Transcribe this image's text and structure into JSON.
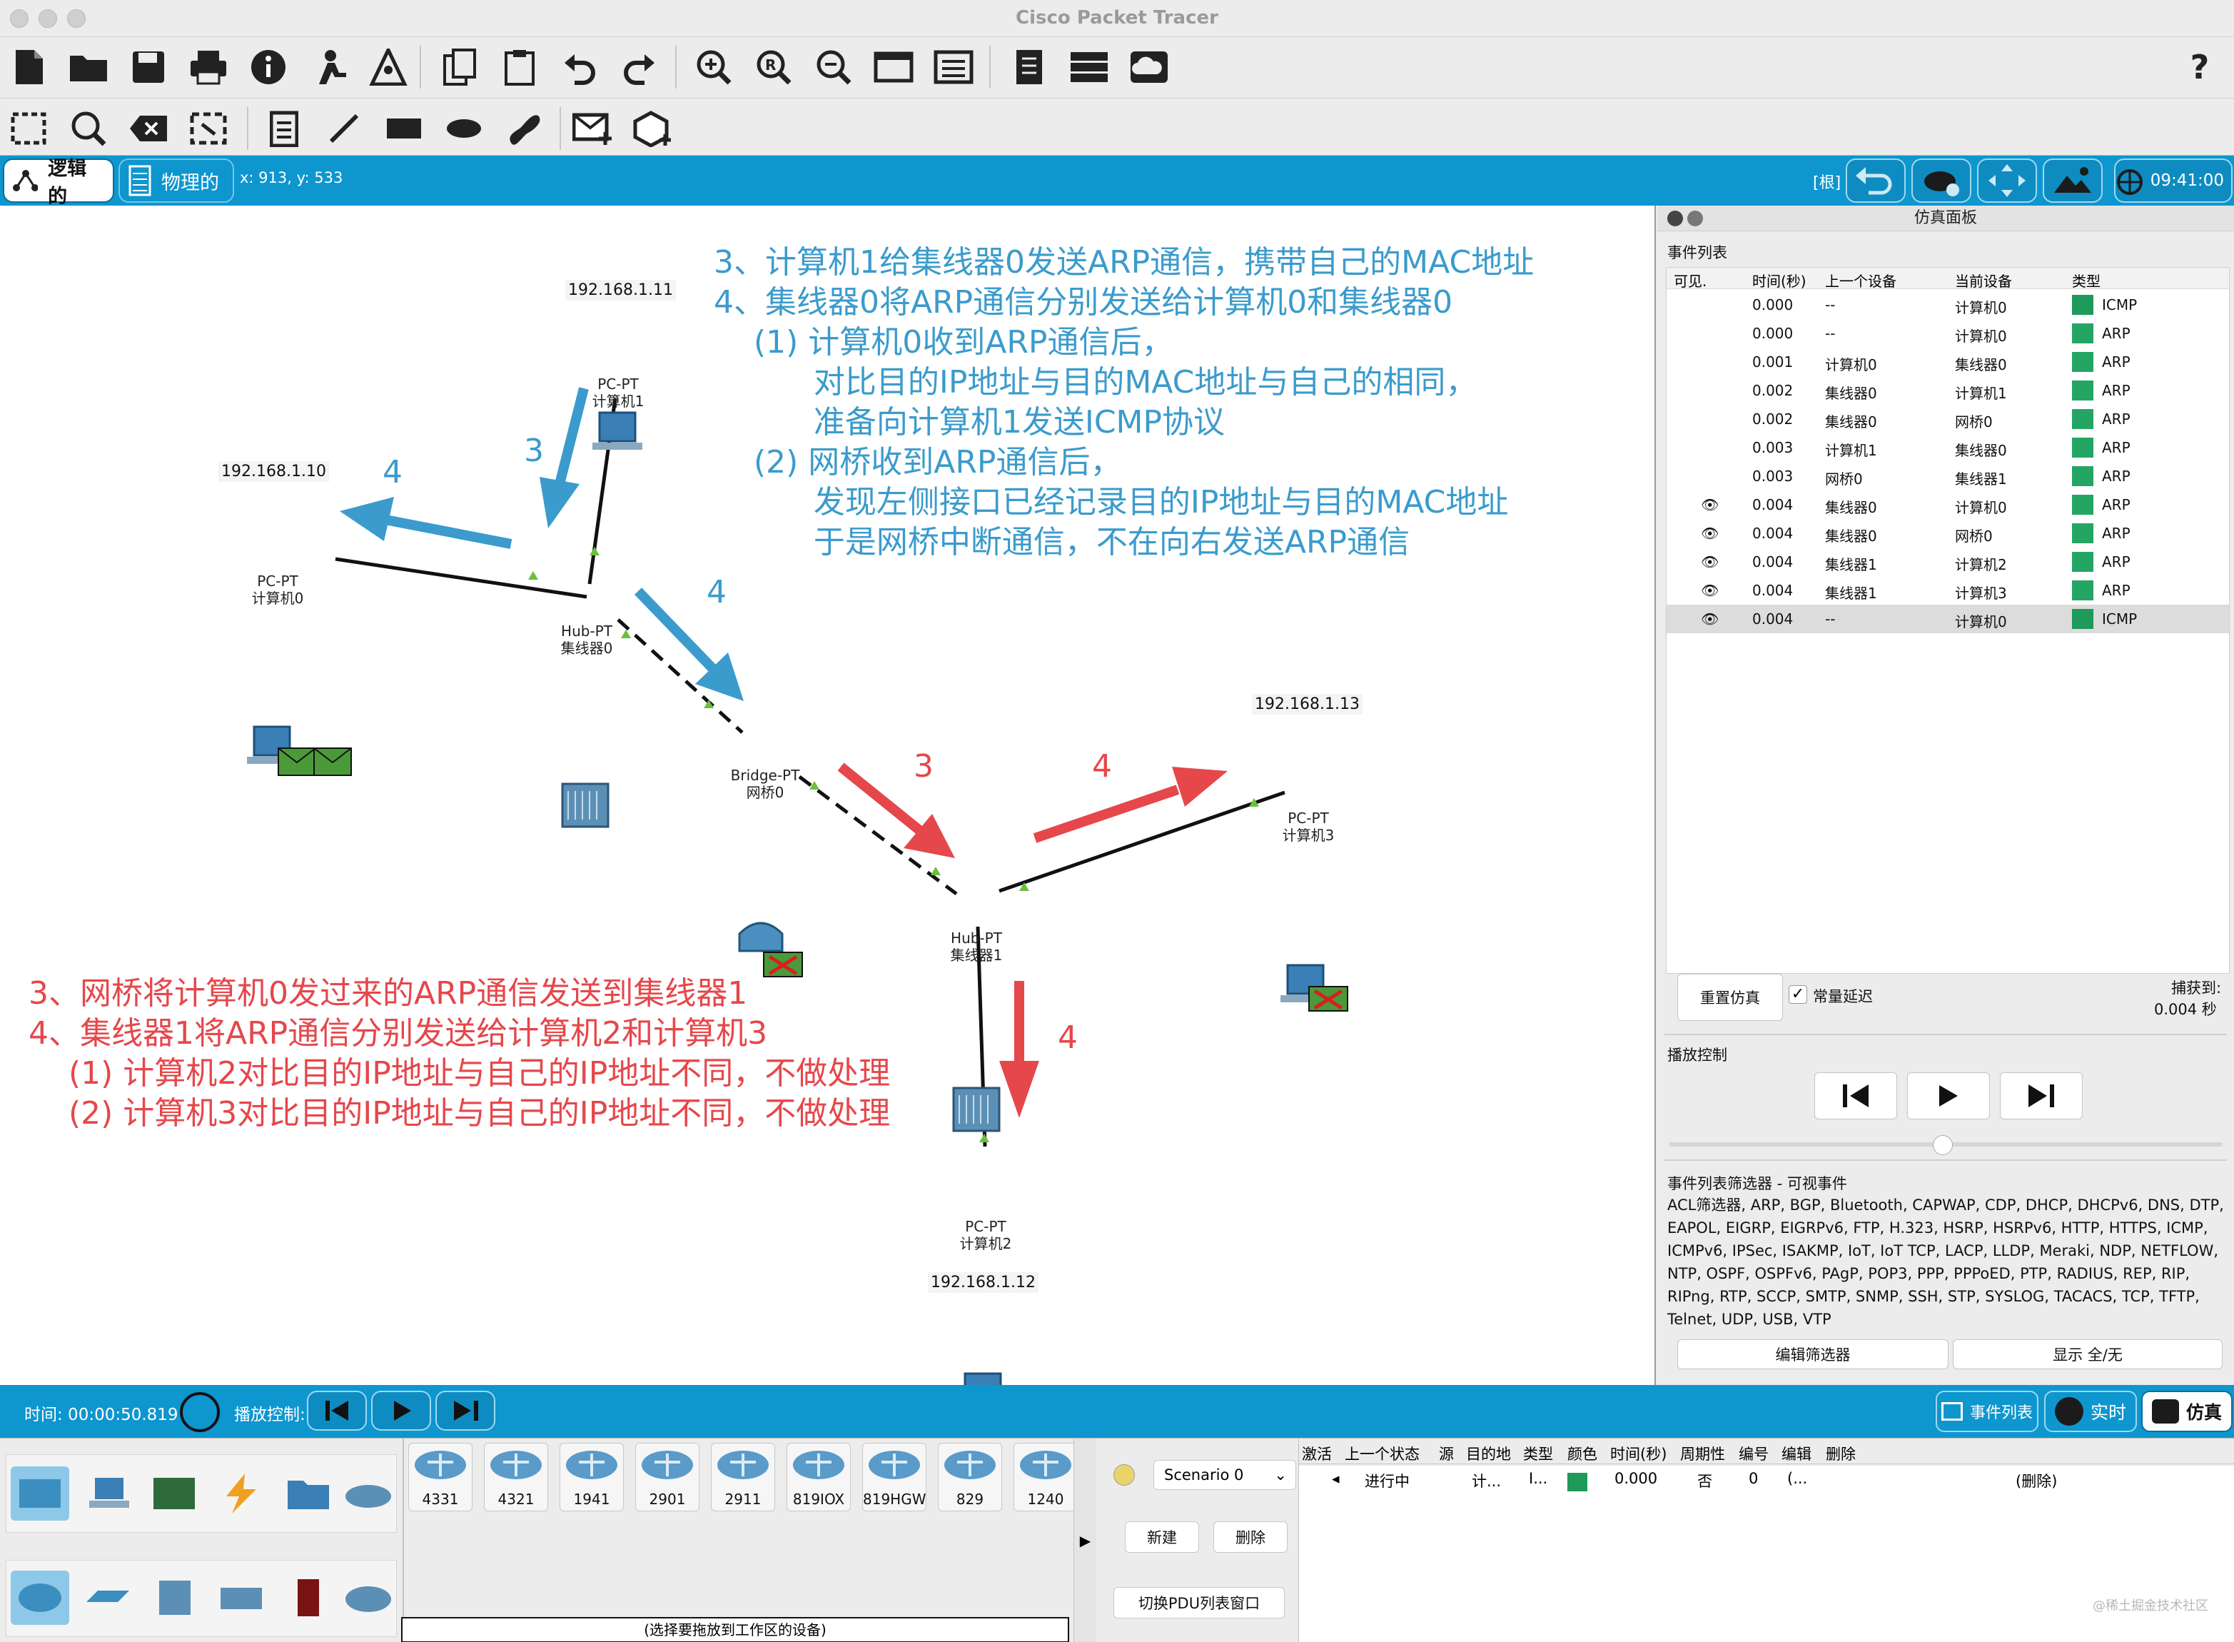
{
  "window": {
    "title": "Cisco Packet Tracer"
  },
  "toolbar1_icons": [
    "new-file-icon",
    "open-folder-icon",
    "save-icon",
    "print-icon",
    "info-icon",
    "activity-wizard-icon",
    "network-info-icon",
    "copy-icon",
    "paste-icon",
    "undo-icon",
    "redo-icon",
    "zoom-in-icon",
    "zoom-reset-icon",
    "zoom-out-icon",
    "drawing-palette-icon",
    "custom-device-icon",
    "view-ipc-icon",
    "server-icon",
    "cloud-icon",
    "help-icon"
  ],
  "toolbar2_icons": [
    "select-icon",
    "inspect-icon",
    "delete-icon",
    "resize-icon",
    "place-note-icon",
    "draw-line-icon",
    "draw-rectangle-icon",
    "draw-ellipse-icon",
    "freeform-icon",
    "add-simple-pdu-icon",
    "add-complex-pdu-icon"
  ],
  "viewbar": {
    "logical": "逻辑的",
    "physical": "物理的",
    "coords": "x: 913, y: 533",
    "root": "[根]",
    "clock": "09:41:00"
  },
  "annotations": {
    "blue": "3、计算机1给集线器0发送ARP通信，携带自己的MAC地址\n4、集线器0将ARP通信分别发送给计算机0和集线器0\n    (1) 计算机0收到ARP通信后，\n          对比目的IP地址与目的MAC地址与自己的相同，\n          准备向计算机1发送ICMP协议\n    (2) 网桥收到ARP通信后，\n          发现左侧接口已经记录目的IP地址与目的MAC地址\n          于是网桥中断通信，不在向右发送ARP通信",
    "red": "3、网桥将计算机0发过来的ARP通信发送到集线器1\n4、集线器1将ARP通信分别发送给计算机2和计算机3\n    (1) 计算机2对比目的IP地址与自己的IP地址不同，不做处理\n    (2) 计算机3对比目的IP地址与自己的IP地址不同，不做处理",
    "arrow_numbers": {
      "a": "3",
      "b": "4",
      "c": "4",
      "d": "3",
      "e": "4",
      "f": "4"
    }
  },
  "devices": {
    "pc1": {
      "type": "PC-PT",
      "name": "计算机1",
      "ip": "192.168.1.11"
    },
    "pc0": {
      "type": "PC-PT",
      "name": "计算机0",
      "ip": "192.168.1.10"
    },
    "hub0": {
      "type": "Hub-PT",
      "name": "集线器0"
    },
    "bridge0": {
      "type": "Bridge-PT",
      "name": "网桥0"
    },
    "hub1": {
      "type": "Hub-PT",
      "name": "集线器1"
    },
    "pc3": {
      "type": "PC-PT",
      "name": "计算机3",
      "ip": "192.168.1.13"
    },
    "pc2": {
      "type": "PC-PT",
      "name": "计算机2",
      "ip": "192.168.1.12"
    }
  },
  "sim_panel": {
    "title": "仿真面板",
    "event_list_label": "事件列表",
    "columns": [
      "可见.",
      "时间(秒)",
      "上一个设备",
      "当前设备",
      "类型"
    ],
    "events": [
      {
        "visible": "",
        "time": "0.000",
        "last": "--",
        "at": "计算机0",
        "type": "ICMP",
        "color": "#1e9a5a"
      },
      {
        "visible": "",
        "time": "0.000",
        "last": "--",
        "at": "计算机0",
        "type": "ARP",
        "color": "#25a564"
      },
      {
        "visible": "",
        "time": "0.001",
        "last": "计算机0",
        "at": "集线器0",
        "type": "ARP",
        "color": "#25a564"
      },
      {
        "visible": "",
        "time": "0.002",
        "last": "集线器0",
        "at": "计算机1",
        "type": "ARP",
        "color": "#25a564"
      },
      {
        "visible": "",
        "time": "0.002",
        "last": "集线器0",
        "at": "网桥0",
        "type": "ARP",
        "color": "#25a564"
      },
      {
        "visible": "",
        "time": "0.003",
        "last": "计算机1",
        "at": "集线器0",
        "type": "ARP",
        "color": "#25a564"
      },
      {
        "visible": "",
        "time": "0.003",
        "last": "网桥0",
        "at": "集线器1",
        "type": "ARP",
        "color": "#25a564"
      },
      {
        "visible": "eye",
        "time": "0.004",
        "last": "集线器0",
        "at": "计算机0",
        "type": "ARP",
        "color": "#25a564"
      },
      {
        "visible": "eye",
        "time": "0.004",
        "last": "集线器0",
        "at": "网桥0",
        "type": "ARP",
        "color": "#25a564"
      },
      {
        "visible": "eye",
        "time": "0.004",
        "last": "集线器1",
        "at": "计算机2",
        "type": "ARP",
        "color": "#25a564"
      },
      {
        "visible": "eye",
        "time": "0.004",
        "last": "集线器1",
        "at": "计算机3",
        "type": "ARP",
        "color": "#25a564"
      },
      {
        "visible": "eye",
        "time": "0.004",
        "last": "--",
        "at": "计算机0",
        "type": "ICMP",
        "color": "#1e9a5a"
      }
    ],
    "reset_label": "重置仿真",
    "constant_delay_label": "常量延迟",
    "constant_delay_checked": true,
    "captured_label": "捕获到:",
    "captured_value": "0.004 秒",
    "playback_label": "播放控制",
    "filter_title": "事件列表筛选器 - 可视事件",
    "filter_text": "ACL筛选器, ARP, BGP, Bluetooth, CAPWAP, CDP, DHCP, DHCPv6, DNS, DTP, EAPOL, EIGRP, EIGRPv6, FTP, H.323, HSRP, HSRPv6, HTTP, HTTPS, ICMP, ICMPv6, IPSec, ISAKMP, IoT, IoT TCP, LACP, LLDP, Meraki, NDP, NETFLOW, NTP, OSPF, OSPFv6, PAgP, POP3, PPP, PPPoED, PTP, RADIUS, REP, RIP, RIPng, RTP, SCCP, SMTP, SNMP, SSH, STP, SYSLOG, TACACS, TCP, TFTP, Telnet, UDP, USB, VTP",
    "edit_filter_label": "编辑筛选器",
    "show_all_label": "显示 全/无"
  },
  "bottom_bar": {
    "time_label": "时间: 00:00:50.819",
    "playback_label": "播放控制:",
    "event_list_label": "事件列表",
    "realtime_label": "实时",
    "simulation_label": "仿真"
  },
  "device_palette": {
    "routers": [
      "4331",
      "4321",
      "1941",
      "2901",
      "2911",
      "819IOX",
      "819HGW",
      "829",
      "1240"
    ],
    "hint": "(选择要拖放到工作区的设备)"
  },
  "scenario": {
    "selected": "Scenario 0",
    "new_label": "新建",
    "delete_label": "删除",
    "toggle_pdu_label": "切换PDU列表窗口"
  },
  "pdu_table": {
    "columns": [
      "激活",
      "上一个状态",
      "源",
      "目的地",
      "类型",
      "颜色",
      "时间(秒)",
      "周期性",
      "编号",
      "编辑",
      "删除"
    ],
    "row": {
      "status": "进行中",
      "source": "计...",
      "destination": "I...",
      "time": "0.000",
      "periodic": "否",
      "num": "0",
      "edit": "(...",
      "delete": "(删除)",
      "color": "#1e9a5a"
    }
  },
  "watermark": "@稀土掘金技术社区"
}
